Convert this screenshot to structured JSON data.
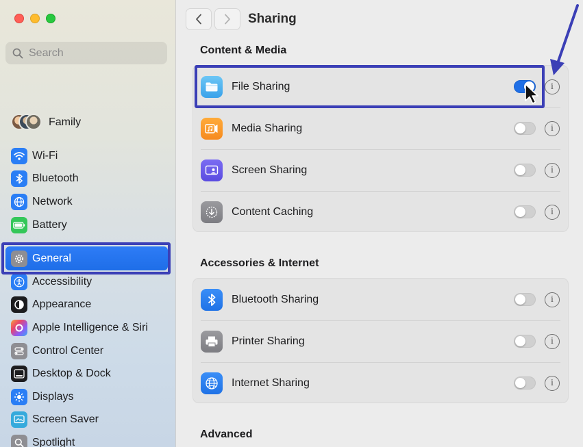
{
  "colors": {
    "accent": "#1f6fe6",
    "annotation": "#3b3fb6"
  },
  "search": {
    "placeholder": "Search"
  },
  "family": {
    "label": "Family"
  },
  "sidebar": {
    "group1": [
      {
        "label": "Wi-Fi",
        "icon": "wifi-icon"
      },
      {
        "label": "Bluetooth",
        "icon": "bluetooth-icon"
      },
      {
        "label": "Network",
        "icon": "globe-icon"
      },
      {
        "label": "Battery",
        "icon": "battery-icon"
      }
    ],
    "group2": [
      {
        "label": "General",
        "icon": "gear-icon",
        "selected": true
      },
      {
        "label": "Accessibility",
        "icon": "accessibility-icon"
      },
      {
        "label": "Appearance",
        "icon": "appearance-icon"
      },
      {
        "label": "Apple Intelligence & Siri",
        "icon": "siri-icon"
      },
      {
        "label": "Control Center",
        "icon": "control-center-icon"
      },
      {
        "label": "Desktop & Dock",
        "icon": "dock-icon"
      },
      {
        "label": "Displays",
        "icon": "sun-icon"
      },
      {
        "label": "Screen Saver",
        "icon": "screen-saver-icon"
      },
      {
        "label": "Spotlight",
        "icon": "spotlight-icon"
      }
    ]
  },
  "main": {
    "title": "Sharing",
    "sections": [
      {
        "title": "Content & Media",
        "rows": [
          {
            "label": "File Sharing",
            "enabled": true,
            "icon": "folder-icon"
          },
          {
            "label": "Media Sharing",
            "enabled": false,
            "icon": "media-icon"
          },
          {
            "label": "Screen Sharing",
            "enabled": false,
            "icon": "screen-sharing-icon"
          },
          {
            "label": "Content Caching",
            "enabled": false,
            "icon": "caching-icon"
          }
        ]
      },
      {
        "title": "Accessories & Internet",
        "rows": [
          {
            "label": "Bluetooth Sharing",
            "enabled": false,
            "icon": "bluetooth-icon"
          },
          {
            "label": "Printer Sharing",
            "enabled": false,
            "icon": "printer-icon"
          },
          {
            "label": "Internet Sharing",
            "enabled": false,
            "icon": "globe-icon"
          }
        ]
      },
      {
        "title": "Advanced",
        "rows": []
      }
    ],
    "info_glyph": "i"
  }
}
